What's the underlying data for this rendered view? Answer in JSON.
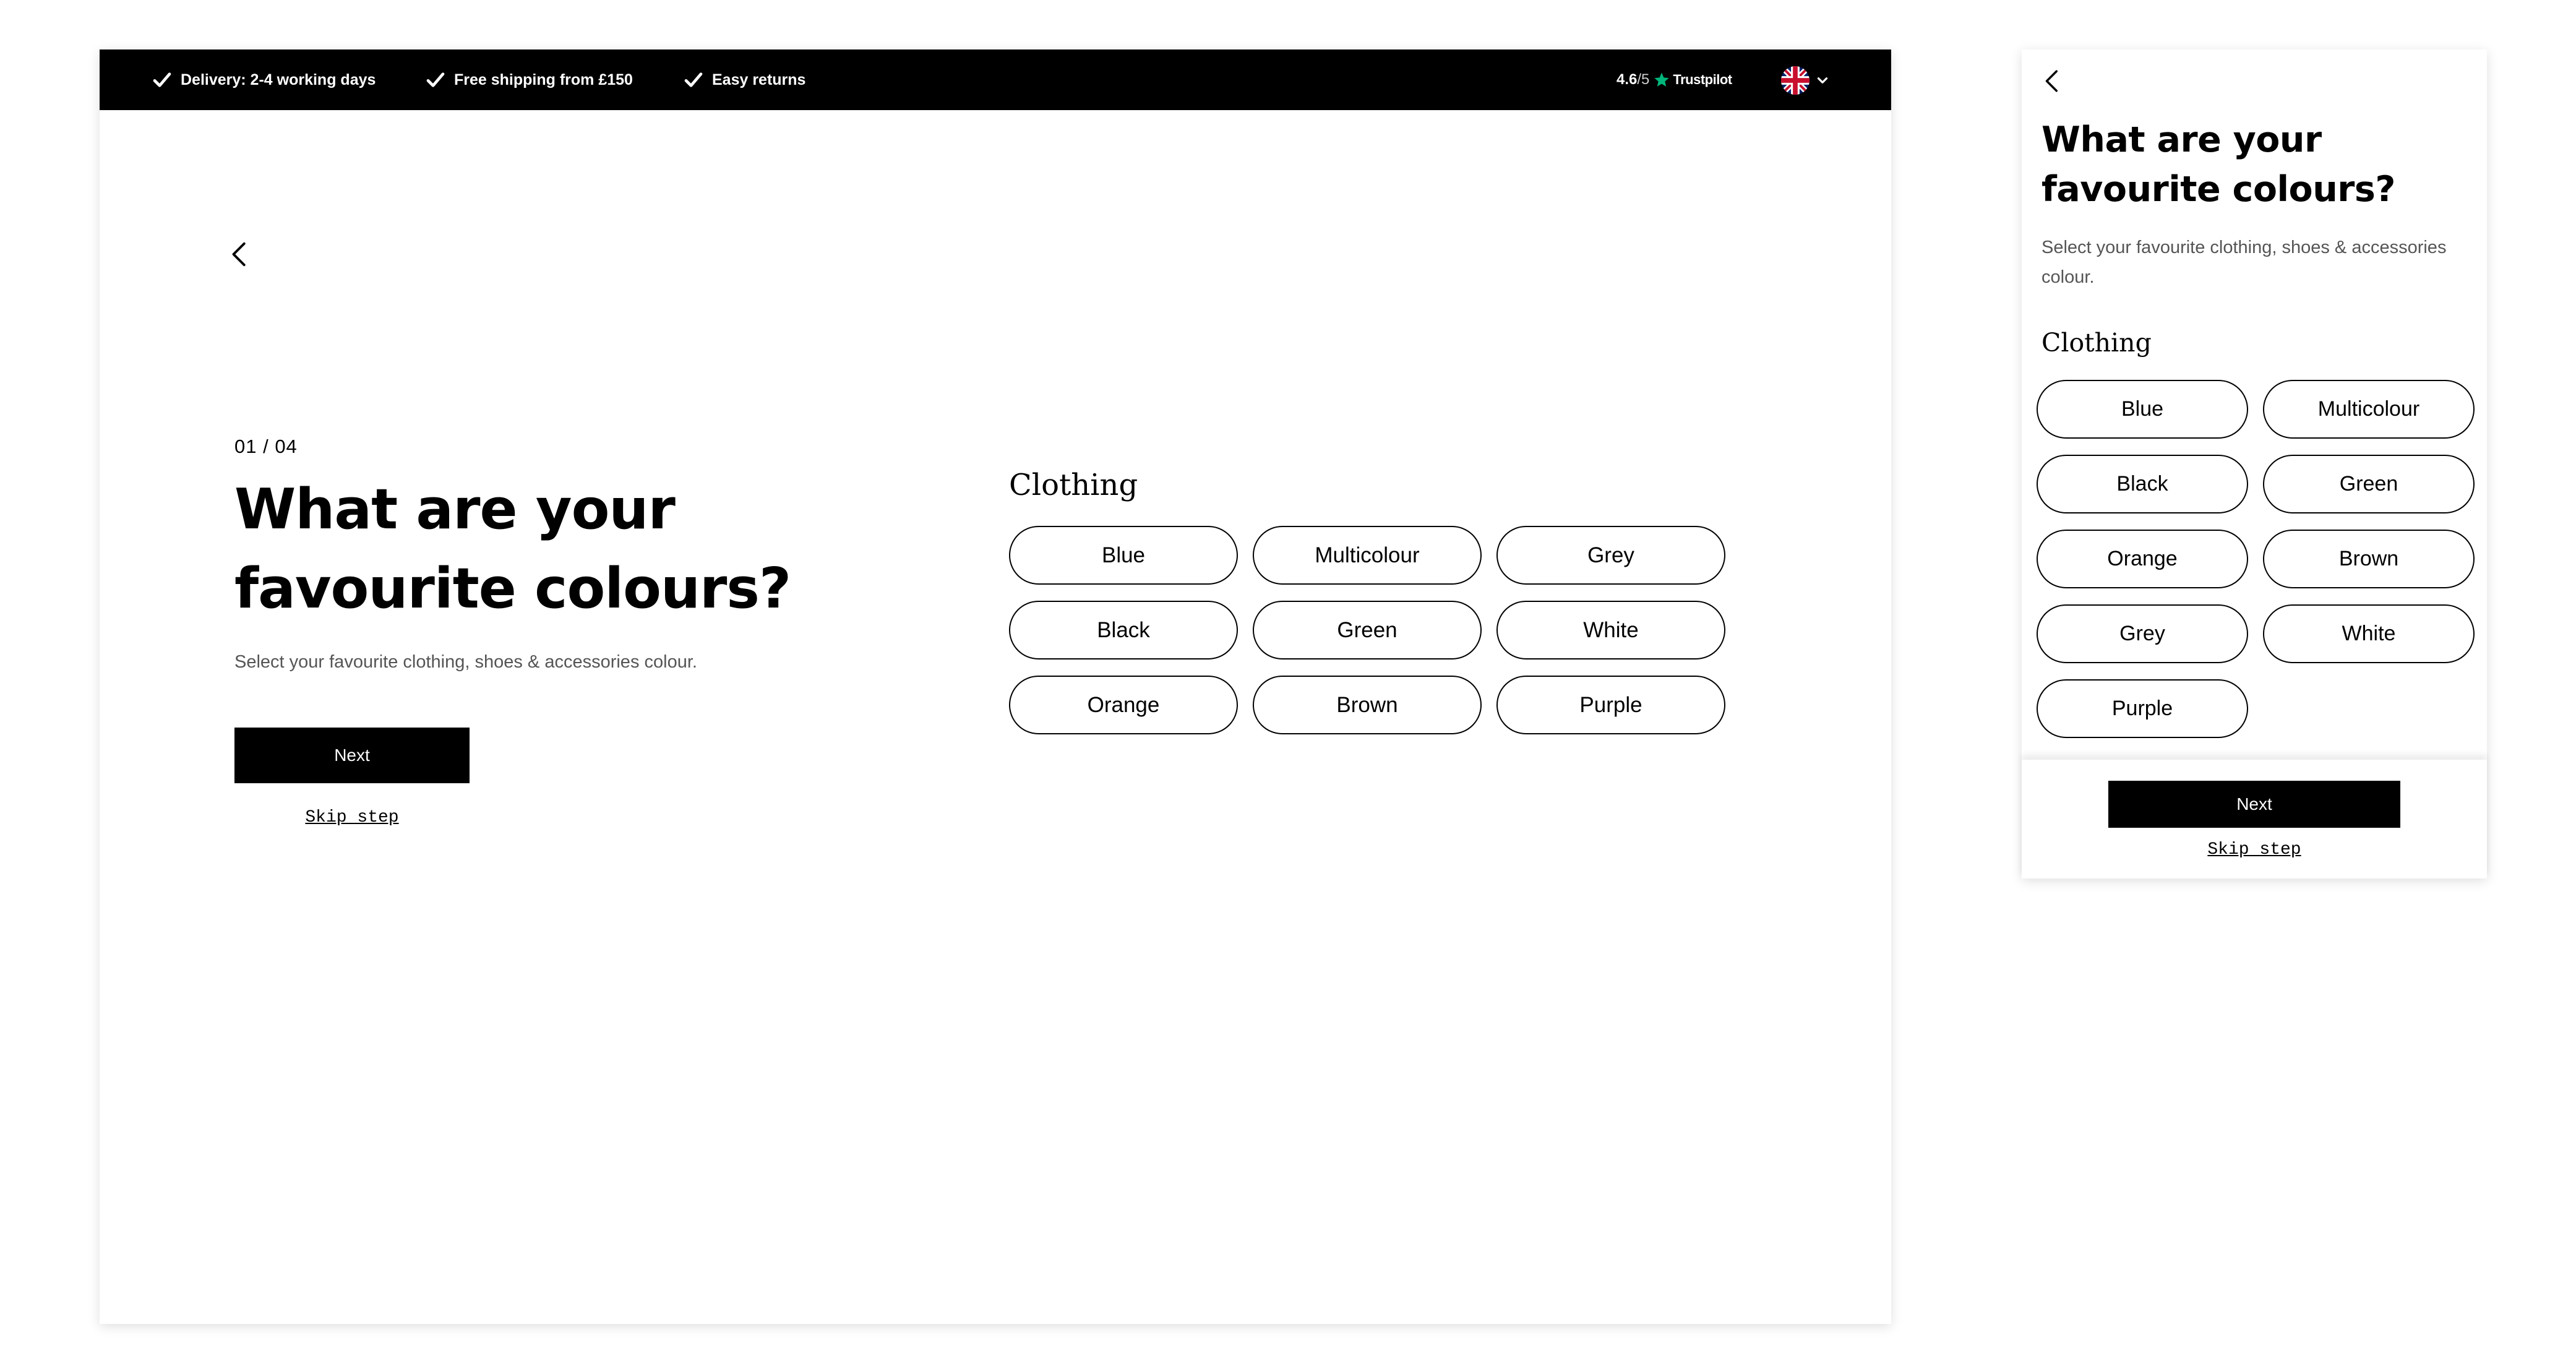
{
  "topbar": {
    "usps": [
      "Delivery: 2-4 working days",
      "Free shipping from £150",
      "Easy returns"
    ],
    "rating_score": "4.6",
    "rating_of": "/5",
    "rating_brand": "Trustpilot",
    "language_icon": "uk-flag-icon"
  },
  "quiz": {
    "step": "01 / 04",
    "title": "What are your favourite colours?",
    "subtitle": "Select your favourite clothing, shoes & accessories colour.",
    "group_label": "Clothing",
    "next_label": "Next",
    "skip_label": "Skip step"
  },
  "desktop_options": [
    "Blue",
    "Multicolour",
    "Grey",
    "Black",
    "Green",
    "White",
    "Orange",
    "Brown",
    "Purple"
  ],
  "mobile_options": [
    "Blue",
    "Multicolour",
    "Black",
    "Green",
    "Orange",
    "Brown",
    "Grey",
    "White",
    "Purple"
  ],
  "colors": {
    "background": "#ffffff",
    "topbar": "#000000",
    "accent": "#000000",
    "trustpilot_star": "#00b67a",
    "subtitle": "#555555"
  }
}
